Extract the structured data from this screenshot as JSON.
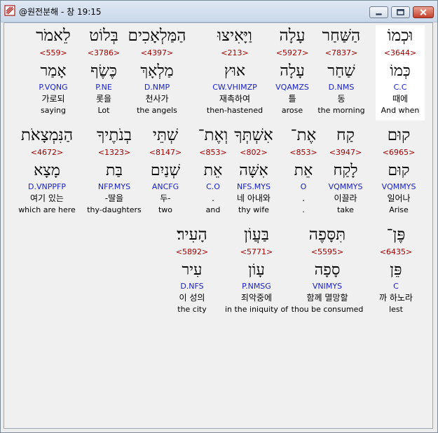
{
  "window": {
    "title": "@원전분해 - 창 19:15",
    "icon": "bible-app-icon",
    "controls": [
      "minimize",
      "maximize",
      "close"
    ]
  },
  "verse": {
    "rows": [
      [
        {
          "hebrew": "וּכְמוֹ",
          "strong": "<3644>",
          "lemma": "כְּמוֹ",
          "morph": "C.C",
          "korean": "때에",
          "english": "And when",
          "selected": true
        },
        {
          "hebrew": "הַשַּׁחַר",
          "strong": "<7837>",
          "lemma": "שַׁחַר",
          "morph": "D.NMS",
          "korean": "동",
          "english": "the morning"
        },
        {
          "hebrew": "עָלָה",
          "strong": "<5927>",
          "lemma": "עָלָה",
          "morph": "VQAMZS",
          "korean": "틀",
          "english": "arose"
        },
        {
          "hebrew": "וַיָּאִיצוּ",
          "strong": "<213>",
          "lemma": "אוּץ",
          "morph": "CW.VHIMZP",
          "korean": "재촉하여",
          "english": "then-hastened"
        },
        {
          "hebrew": "הַמַּלְאָכִים",
          "strong": "<4397>",
          "lemma": "מַלְאָךְ",
          "morph": "D.NMP",
          "korean": "천사가",
          "english": "the angels"
        },
        {
          "hebrew": "בְּלוֹט",
          "strong": "<3786>",
          "lemma": "כֶּשֶׂף",
          "morph": "P.NE",
          "korean": "롯을",
          "english": "Lot"
        },
        {
          "hebrew": "לֵאמֹר",
          "strong": "<559>",
          "lemma": "אָמַר",
          "morph": "P.VQNG",
          "korean": "가로되",
          "english": "saying"
        }
      ],
      [
        {
          "hebrew": "קוּם",
          "strong": "<6965>",
          "lemma": "קוּם",
          "morph": "VQMMYS",
          "korean": "일어나",
          "english": "Arise"
        },
        {
          "hebrew": "קַח",
          "strong": "<3947>",
          "lemma": "לָקַח",
          "morph": "VQMMYS",
          "korean": "이끌라",
          "english": "take"
        },
        {
          "hebrew": "אֶת־",
          "strong": "<853>",
          "lemma": "אֵת",
          "morph": "O",
          "korean": ".",
          "english": "."
        },
        {
          "hebrew": "אִשְׁתְּךָ",
          "strong": "<802>",
          "lemma": "אִשָּׁה",
          "morph": "NFS.MYS",
          "korean": "네 아내와",
          "english": "thy wife"
        },
        {
          "hebrew": "וְאֶת־",
          "strong": "<853>",
          "lemma": "אֵת",
          "morph": "C.O",
          "korean": ".",
          "english": "and"
        },
        {
          "hebrew": "שְׁתֵּי",
          "strong": "<8147>",
          "lemma": "שְׁנַיִם",
          "morph": "ANCFG",
          "korean": "두-",
          "english": "two"
        },
        {
          "hebrew": "בְנֹתֶיךָ",
          "strong": "<1323>",
          "lemma": "בַּת",
          "morph": "NFP.MYS",
          "korean": "-딸을",
          "english": "thy-daughters"
        },
        {
          "hebrew": "הַנִּמְצָאֹת",
          "strong": "<4672>",
          "lemma": "מָצָא",
          "morph": "D.VNPPFP",
          "korean": "여기 있는",
          "english": "which are here"
        }
      ],
      [
        {
          "hebrew": "פֶּן־",
          "strong": "<6435>",
          "lemma": "פֵּן",
          "morph": "C",
          "korean": "까 하노라",
          "english": "lest"
        },
        {
          "hebrew": "תִּסָּפֶה",
          "strong": "<5595>",
          "lemma": "סָפָה",
          "morph": "VNIMYS",
          "korean": "함께 멸망할",
          "english": "thou be consumed"
        },
        {
          "hebrew": "בַּעֲוֹן",
          "strong": "<5771>",
          "lemma": "עָוֹן",
          "morph": "P.NMSG",
          "korean": "죄악중에",
          "english": "in the iniquity of"
        },
        {
          "hebrew": "הָעִיר׃",
          "strong": "<5892>",
          "lemma": "עִיר",
          "morph": "D.NFS",
          "korean": "이 성의",
          "english": "the city"
        }
      ]
    ]
  }
}
